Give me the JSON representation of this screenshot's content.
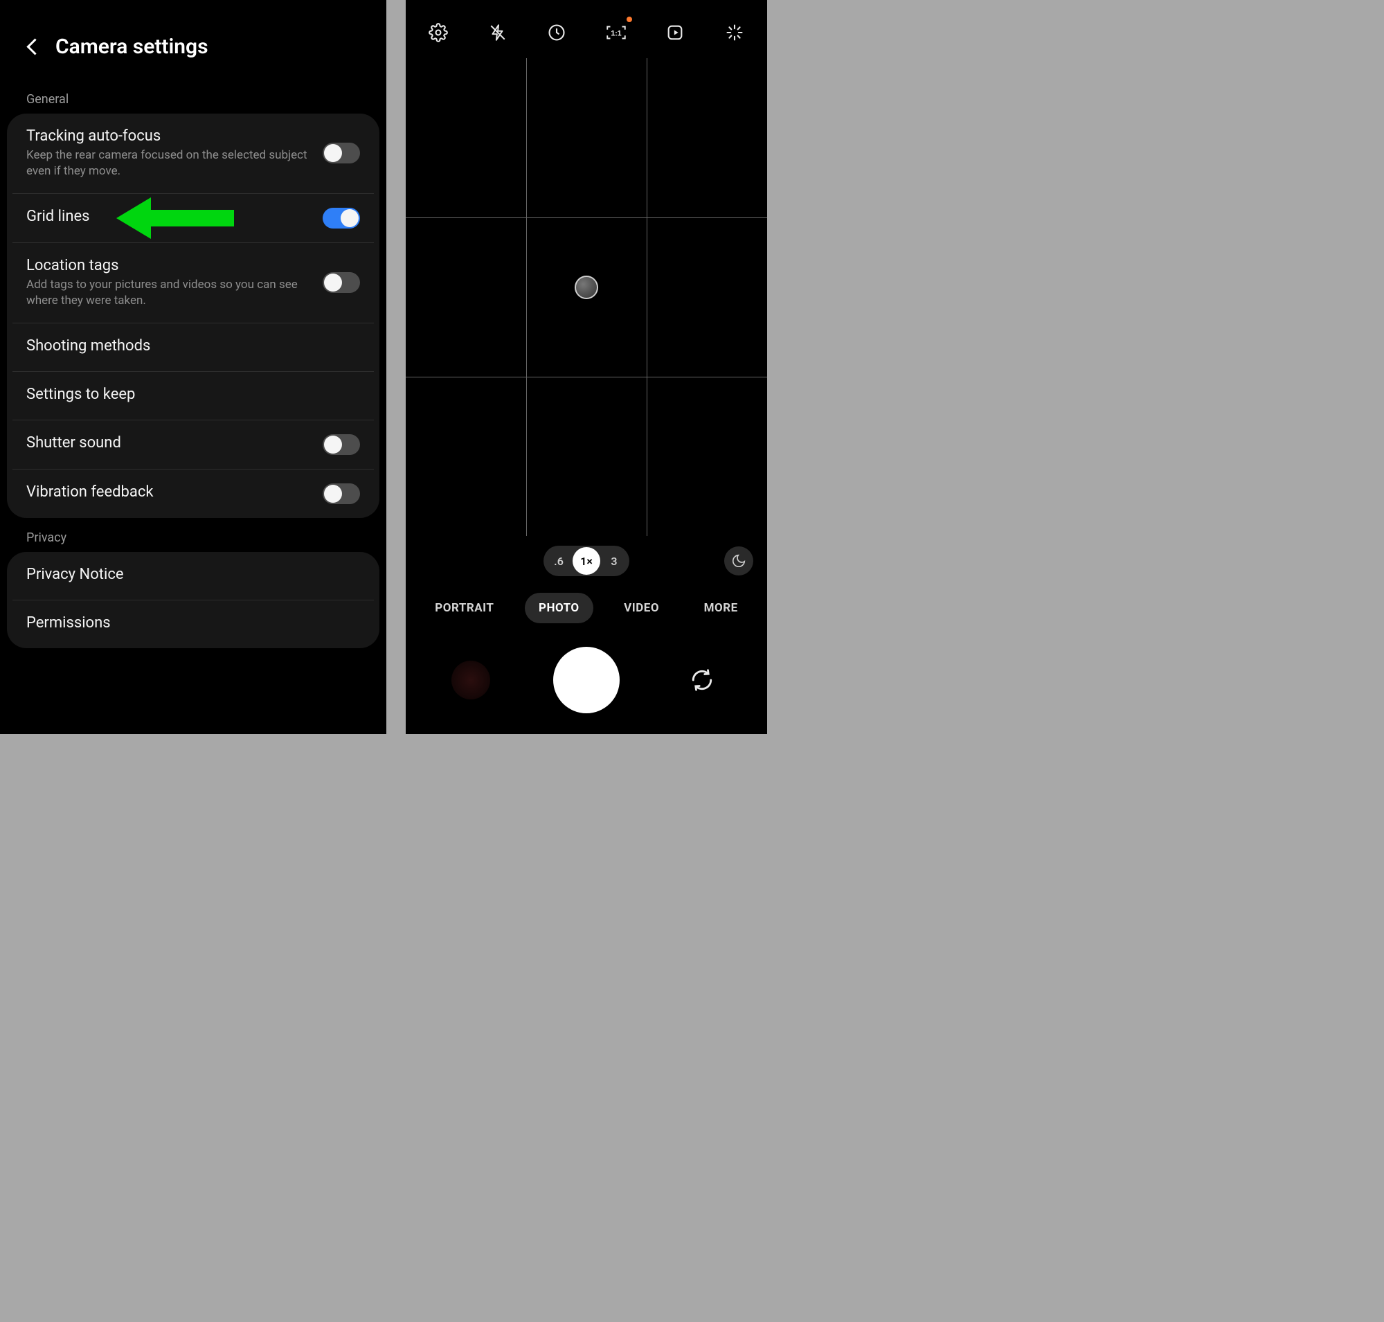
{
  "settings": {
    "title": "Camera settings",
    "sections": {
      "general": {
        "label": "General",
        "items": {
          "tracking": {
            "title": "Tracking auto-focus",
            "sub": "Keep the rear camera focused on the selected subject even if they move.",
            "on": false
          },
          "grid": {
            "title": "Grid lines",
            "on": true
          },
          "location": {
            "title": "Location tags",
            "sub": "Add tags to your pictures and videos so you can see where they were taken.",
            "on": false
          },
          "shooting": {
            "title": "Shooting methods"
          },
          "keep": {
            "title": "Settings to keep"
          },
          "shutterSound": {
            "title": "Shutter sound",
            "on": false
          },
          "vibration": {
            "title": "Vibration feedback",
            "on": false
          }
        }
      },
      "privacy": {
        "label": "Privacy",
        "items": {
          "notice": {
            "title": "Privacy Notice"
          },
          "perms": {
            "title": "Permissions"
          }
        }
      }
    }
  },
  "annotation": {
    "arrow_target": "grid-lines-row",
    "arrow_color": "#00d60f"
  },
  "camera": {
    "topbar_icons": [
      "settings",
      "flash-off",
      "timer",
      "aspect-ratio-1-1",
      "motion-photo",
      "effects"
    ],
    "aspect_badge_has_dot": true,
    "zoom": {
      "options": [
        ".6",
        "1×",
        "3"
      ],
      "active": "1×"
    },
    "night_mode_icon": "moon",
    "modes": {
      "options": [
        "PORTRAIT",
        "PHOTO",
        "VIDEO",
        "MORE"
      ],
      "active": "PHOTO"
    }
  },
  "colors": {
    "toggle_on": "#2f7ff7",
    "toggle_off": "#4d4d4d",
    "card_bg": "#171717",
    "arrow": "#00d60f"
  }
}
